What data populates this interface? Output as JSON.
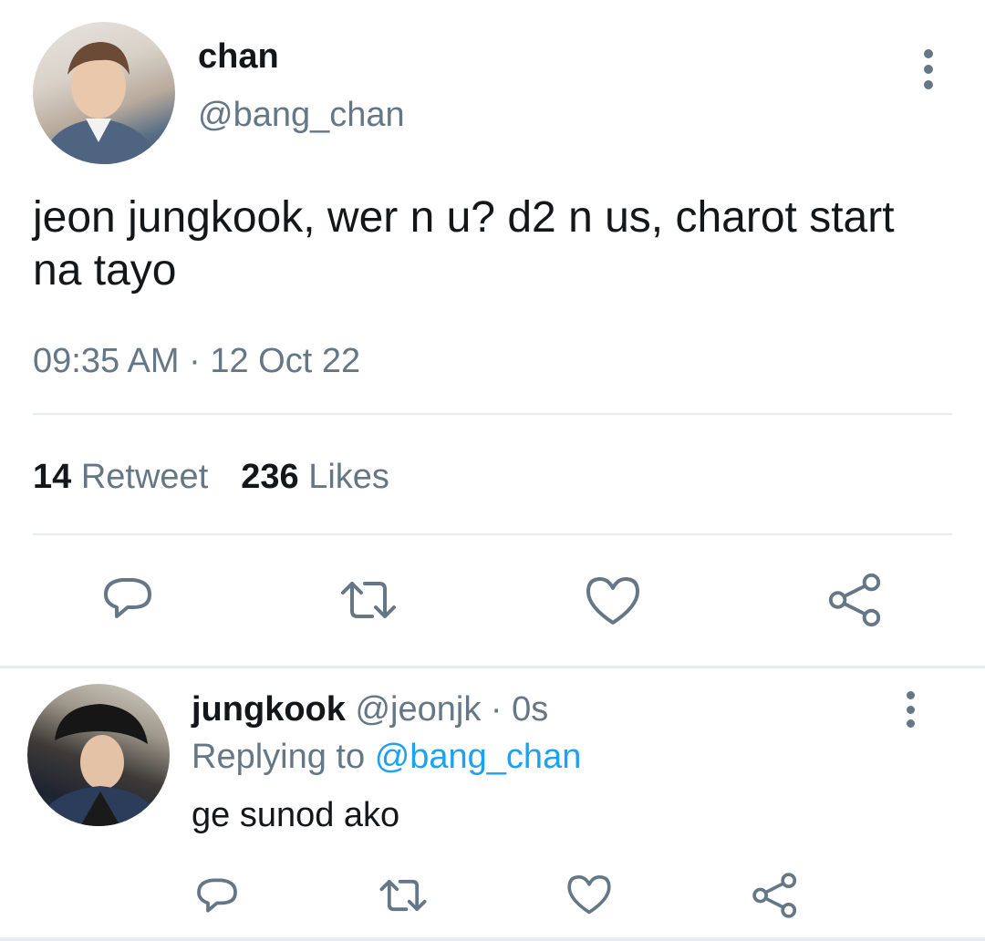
{
  "main_tweet": {
    "display_name": "chan",
    "handle": "@bang_chan",
    "text": "jeon jungkook, wer n u? d2 n us, charot start na tayo",
    "timestamp": "09:35 AM · 12 Oct 22",
    "retweet_count": "14",
    "retweet_label": "Retweet",
    "likes_count": "236",
    "likes_label": "Likes",
    "actions": [
      "reply-icon",
      "retweet-icon",
      "like-icon",
      "share-icon"
    ]
  },
  "reply": {
    "display_name": "jungkook",
    "handle_time": "@jeonjk · 0s",
    "replying_to_label": "Replying to",
    "replying_to_handle": "@bang_chan",
    "text": "ge sunod ako",
    "actions": [
      "reply-icon",
      "retweet-icon",
      "like-icon",
      "share-icon"
    ]
  },
  "colors": {
    "text": "#14171a",
    "secondary": "#657786",
    "mention": "#1da1f2",
    "divider": "#e6ecf0"
  }
}
